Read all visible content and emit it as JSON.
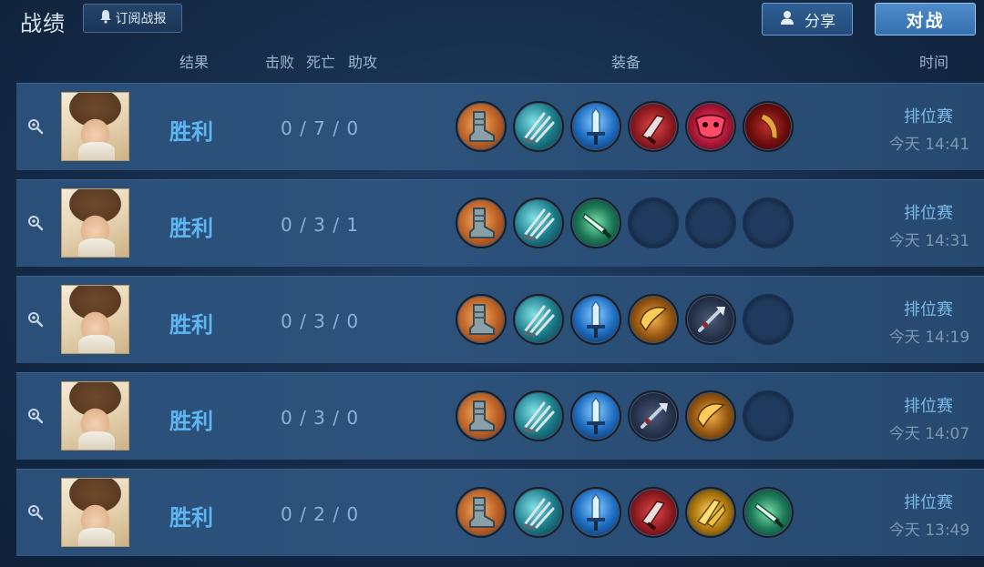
{
  "header": {
    "title": "战绩",
    "subscribe_label": "订阅战报",
    "share_label": "分享",
    "battle_label": "对战"
  },
  "columns": {
    "result": "结果",
    "kills": "击败",
    "deaths": "死亡",
    "assists": "助攻",
    "equipment": "装备",
    "time": "时间"
  },
  "matches": [
    {
      "result": "胜利",
      "kda": "0 / 7 / 0",
      "mode": "排位赛",
      "time": "今天 14:41",
      "equipment": [
        "boots",
        "claw",
        "sword",
        "redblade",
        "mask",
        "fang"
      ]
    },
    {
      "result": "胜利",
      "kda": "0 / 3 / 1",
      "mode": "排位赛",
      "time": "今天 14:31",
      "equipment": [
        "boots",
        "claw",
        "dagger",
        "empty",
        "empty",
        "empty"
      ]
    },
    {
      "result": "胜利",
      "kda": "0 / 3 / 0",
      "mode": "排位赛",
      "time": "今天 14:19",
      "equipment": [
        "boots",
        "claw",
        "sword",
        "bow",
        "spear",
        "empty"
      ]
    },
    {
      "result": "胜利",
      "kda": "0 / 3 / 0",
      "mode": "排位赛",
      "time": "今天 14:07",
      "equipment": [
        "boots",
        "claw",
        "sword",
        "spear",
        "bow",
        "empty"
      ]
    },
    {
      "result": "胜利",
      "kda": "0 / 2 / 0",
      "mode": "排位赛",
      "time": "今天 13:49",
      "equipment": [
        "boots",
        "claw",
        "sword",
        "redblade",
        "gold",
        "dagger"
      ]
    }
  ],
  "icons": {
    "subscribe": "bell-icon",
    "share": "user-share-icon",
    "detail": "magnifier-icon",
    "avatar": "hero-avatar"
  },
  "colors": {
    "result": "#5eb6f2",
    "mode": "#7bb8e8",
    "time": "#7f97b2"
  }
}
